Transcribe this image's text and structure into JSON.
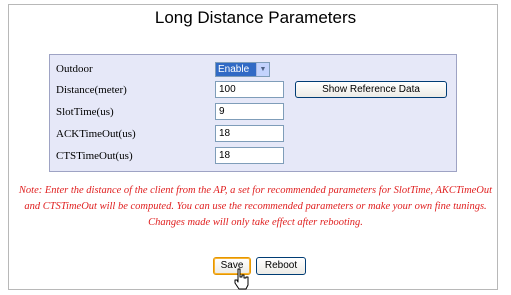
{
  "page": {
    "title": "Long Distance Parameters"
  },
  "params": {
    "outdoor_label": "Outdoor",
    "outdoor_value": "Enable",
    "distance_label": "Distance(meter)",
    "distance_value": "100",
    "reference_button": "Show Reference Data",
    "slot_label": "SlotTime(us)",
    "slot_value": "9",
    "ack_label": "ACKTimeOut(us)",
    "ack_value": "18",
    "cts_label": "CTSTimeOut(us)",
    "cts_value": "18"
  },
  "note": {
    "text": "Note: Enter the distance of the client from the AP, a set for recommended parameters for SlotTime, AKCTimeOut and CTSTimeOut will be computed. You can use the recommended parameters or make your own fine tunings. Changes made will only take effect after rebooting."
  },
  "actions": {
    "save_label": "Save",
    "reboot_label": "Reboot"
  },
  "colors": {
    "panel_background": "#e6e8f8",
    "note_text": "#e02020",
    "selected_option": "#316ac5"
  },
  "icons": {
    "dropdown": "chevron-down-icon",
    "pointer": "hand-cursor-icon"
  }
}
